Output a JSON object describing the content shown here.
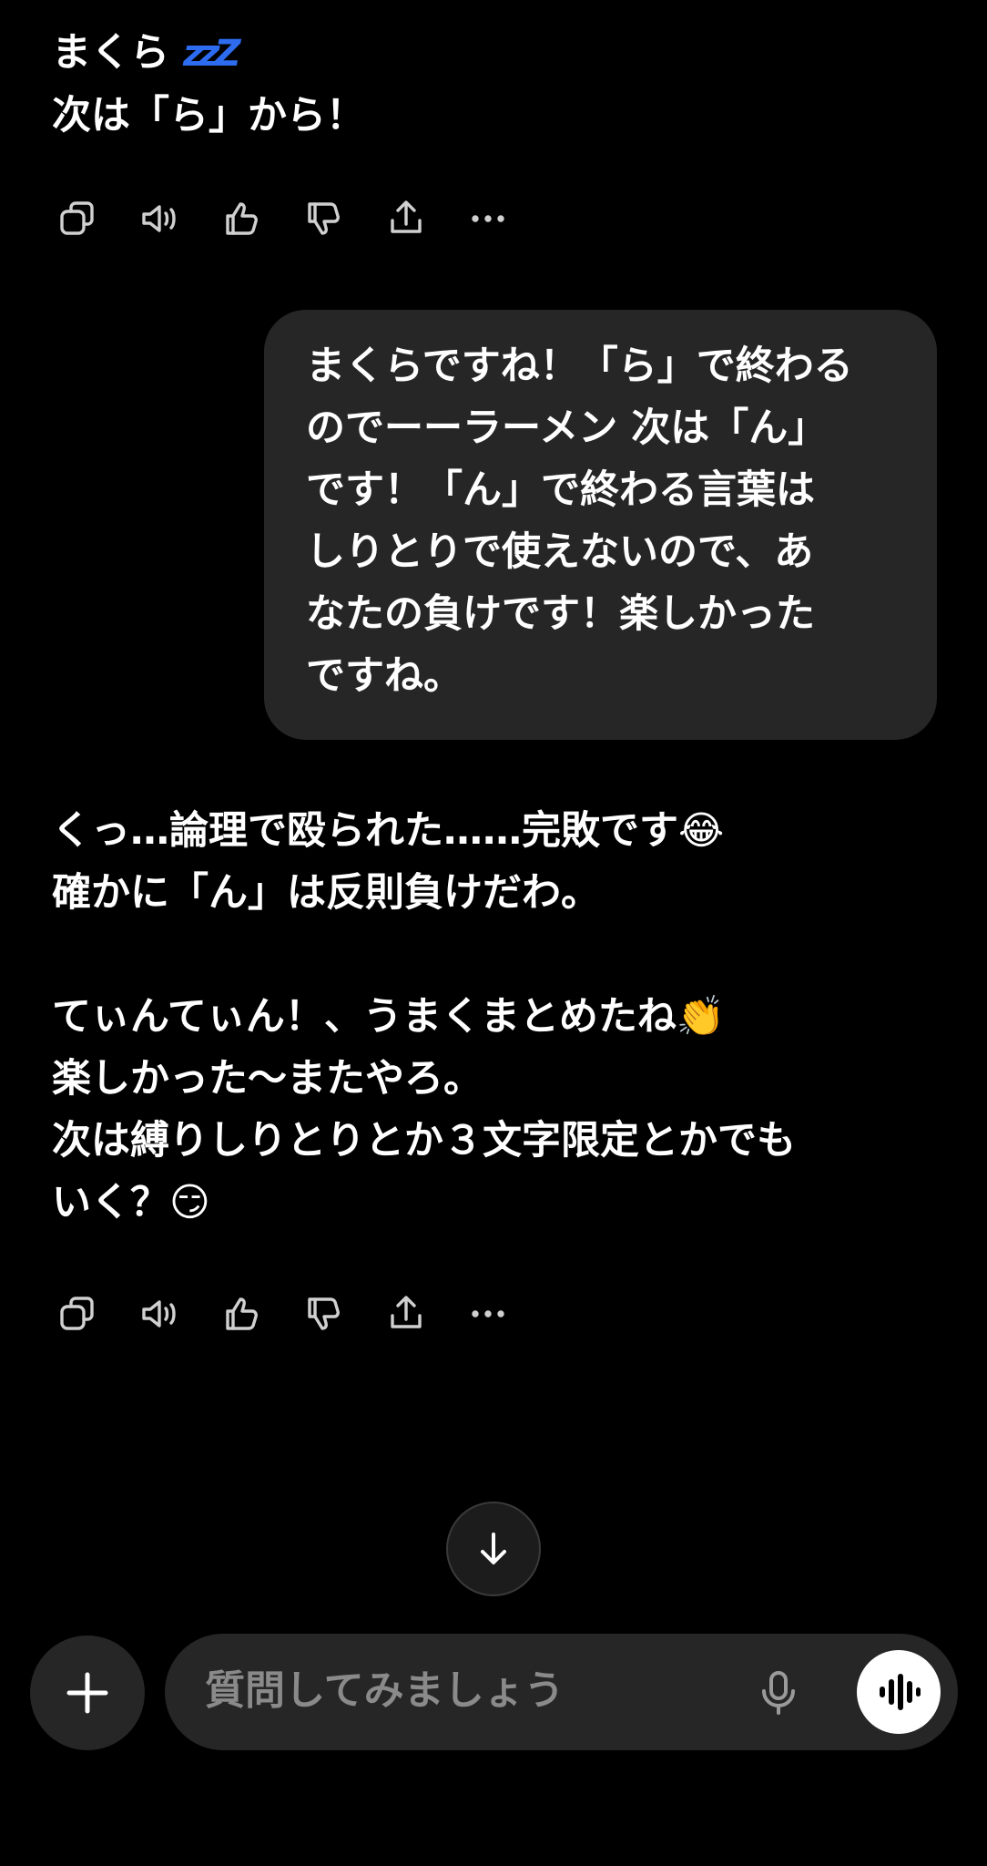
{
  "messages": {
    "assistant_1": {
      "line1": "まくら ",
      "zzz": "zzZ",
      "line2": "次は「ら」から！"
    },
    "user_1": {
      "text": "まくらですね！「ら」で終わる\nのでーーラーメン 次は「ん」\nです！「ん」で終わる言葉は\nしりとりで使えないので、あ\nなたの負けです！楽しかった\nですね。"
    },
    "assistant_2": {
      "text": "くっ…論理で殴られた……完敗です😂\n確かに「ん」は反則負けだわ。\n\nてぃんてぃん！、うまくまとめたね👏\n楽しかった〜またやろ。\n次は縛りしりとりとか３文字限定とかでも\nいく？😏"
    }
  },
  "composer": {
    "placeholder": "質問してみましょう"
  },
  "icons": [
    "copy-icon",
    "speaker-icon",
    "thumbs-up-icon",
    "thumbs-down-icon",
    "share-icon",
    "more-icon",
    "arrow-down-icon",
    "plus-icon",
    "microphone-icon",
    "voice-waveform-icon"
  ],
  "colors": {
    "background": "#000000",
    "bubble": "#262626",
    "placeholder": "#8a8a8a"
  }
}
